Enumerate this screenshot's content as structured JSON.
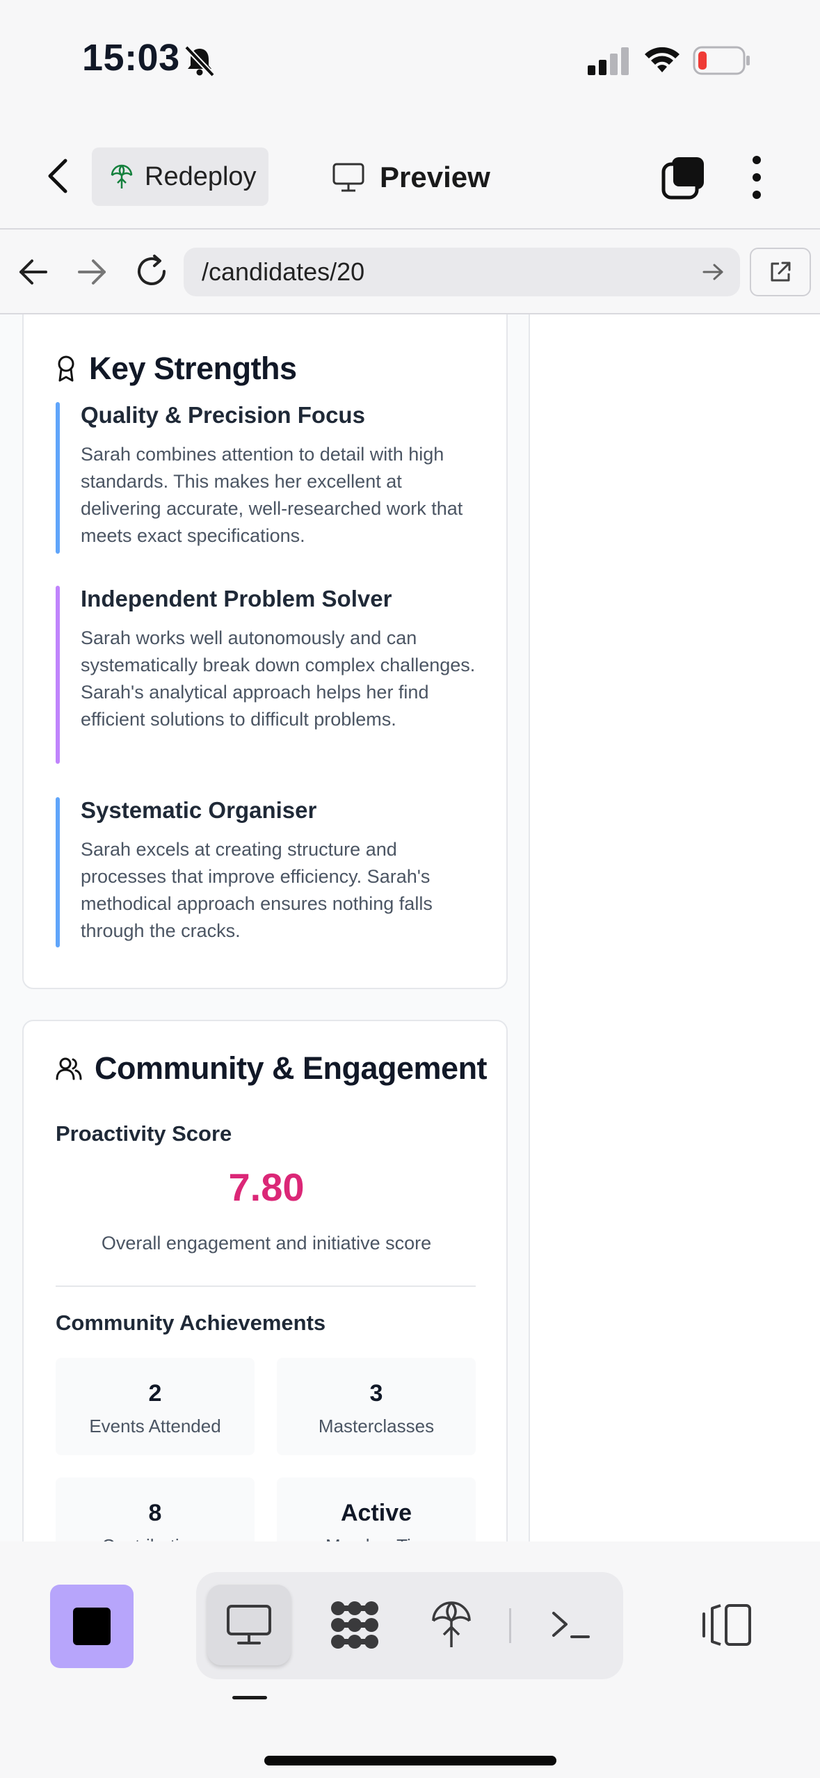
{
  "status_bar": {
    "time": "15:03"
  },
  "header": {
    "redeploy_label": "Redeploy",
    "preview_label": "Preview"
  },
  "browser": {
    "url": "/candidates/20"
  },
  "strengths": {
    "title": "Key Strengths",
    "items": [
      {
        "title": "Quality & Precision Focus",
        "body": "Sarah combines attention to detail with high standards. This makes her excellent at delivering accurate, well-researched work that meets exact specifications.",
        "accent": "#60a5fa"
      },
      {
        "title": "Independent Problem Solver",
        "body": "Sarah works well autonomously and can systematically break down complex challenges. Sarah's analytical approach helps her find efficient solutions to difficult problems.",
        "accent": "#c084fc"
      },
      {
        "title": "Systematic Organiser",
        "body": "Sarah excels at creating structure and processes that improve efficiency. Sarah's methodical approach ensures nothing falls through the cracks.",
        "accent": "#60a5fa"
      }
    ]
  },
  "community": {
    "title": "Community & Engagement",
    "proactivity_label": "Proactivity Score",
    "score": "7.80",
    "score_caption": "Overall engagement and initiative score",
    "achievements_label": "Community Achievements",
    "stats": [
      {
        "value": "2",
        "label": "Events Attended"
      },
      {
        "value": "3",
        "label": "Masterclasses"
      },
      {
        "value": "8",
        "label": "Contributions"
      },
      {
        "value": "Active",
        "label": "Member Tier"
      }
    ]
  },
  "colors": {
    "score": "#db2777",
    "stop_button": "#b7a5fb"
  },
  "icons": {
    "status": [
      "bell-slash-icon",
      "signal-icon",
      "wifi-icon",
      "battery-low-icon"
    ],
    "toolbar": [
      "stop-icon",
      "desktop-icon",
      "blocks-icon",
      "deploy-icon",
      "terminal-icon",
      "layout-icon"
    ]
  }
}
